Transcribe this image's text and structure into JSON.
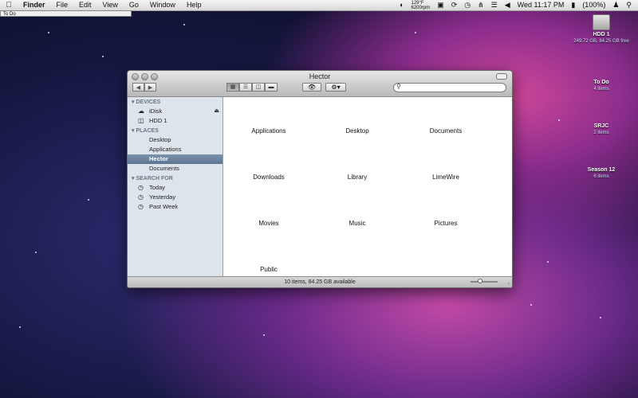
{
  "menubar": {
    "apple": "",
    "app": "Finder",
    "menus": [
      "File",
      "Edit",
      "View",
      "Go",
      "Window",
      "Help"
    ],
    "temp_top": "129°F",
    "temp_bottom": "6200rpm",
    "clock": "Wed 11:17 PM",
    "battery": "(100%)",
    "icons": [
      "weather-icon",
      "dropbox-icon",
      "sync-icon",
      "time-machine-icon",
      "bluetooth-icon",
      "wifi-icon",
      "volume-icon",
      "battery-icon",
      "user-icon",
      "spotlight-icon"
    ]
  },
  "todo_strip": "To Do",
  "desktop": {
    "hdd": {
      "name": "HDD 1",
      "sub": "249.72 GB, 84.25 GB free"
    },
    "items": [
      {
        "name": "To Do",
        "sub": "4 items"
      },
      {
        "name": "SRJC",
        "sub": "2 items"
      },
      {
        "name": "Season 12",
        "sub": "6 items"
      }
    ]
  },
  "window": {
    "title": "Hector",
    "search_placeholder": "",
    "sidebar": {
      "devices_label": "DEVICES",
      "devices": [
        "iDisk",
        "HDD 1"
      ],
      "places_label": "PLACES",
      "places": [
        "Desktop",
        "Applications",
        "Hector",
        "Documents"
      ],
      "selected": "Hector",
      "search_label": "SEARCH FOR",
      "searches": [
        "Today",
        "Yesterday",
        "Past Week"
      ]
    },
    "files": [
      "Applications",
      "Desktop",
      "Documents",
      "Downloads",
      "Library",
      "LimeWire",
      "Movies",
      "Music",
      "Pictures",
      "Public"
    ],
    "status": "10 items, 84.25 GB available"
  }
}
